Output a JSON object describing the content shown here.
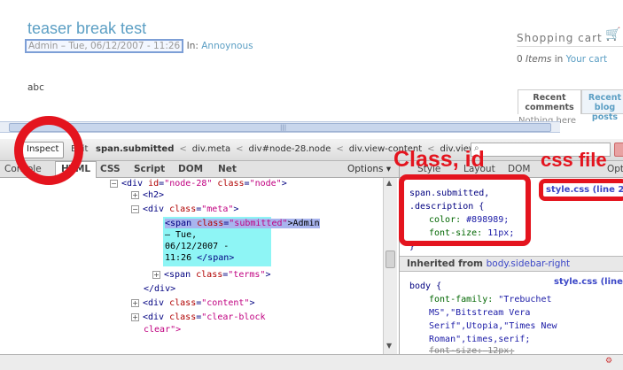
{
  "page": {
    "title": "teaser break test",
    "submitted": "Admin – Tue, 06/12/2007 - 11:26",
    "in_label": "In:",
    "category": "Annoynous",
    "body": "abc"
  },
  "cart": {
    "title": "Shopping cart",
    "count_text": "0",
    "items_text": "Items",
    "in_text": "in",
    "link": "Your cart"
  },
  "recent": {
    "tab_comments": "Recent comments",
    "tab_posts": "Recent blog posts",
    "empty_text": "Nothing here"
  },
  "firebug": {
    "toolbar": {
      "inspect": "Inspect",
      "edit": "Edit",
      "breadcrumb": [
        "span.submitted",
        "div.meta",
        "div#node-28.node",
        "div.view-content",
        "div.view"
      ]
    },
    "tabs": [
      "Console",
      "HTML",
      "CSS",
      "Script",
      "DOM",
      "Net"
    ],
    "active_tab": "HTML",
    "options": "Options ▾",
    "right_tabs": [
      "Style",
      "Layout",
      "DOM"
    ],
    "right_options": "Options",
    "tree": [
      {
        "tag_open": "<div",
        "attr1": "id",
        "val1": "\"node-28\"",
        "attr2": "class",
        "val2": "\"node\"",
        "close": ">"
      },
      {
        "text": "<h2>"
      },
      {
        "text_open": "<div",
        "attr": "class",
        "val": "\"meta\"",
        "close": ">"
      },
      {
        "text": "<span",
        "attr": "class",
        "val": "\"terms\"",
        "close": ">"
      },
      {
        "text": "</div>"
      },
      {
        "text_open": "<div",
        "attr": "class",
        "val": "\"content\"",
        "close": ">"
      },
      {
        "text_open": "<div",
        "attr": "class",
        "val": "\"clear-block",
        "cont": "clear\">"
      }
    ],
    "selected_node": {
      "line1_open": "<span",
      "line1_attr": "class",
      "line1_val": "\"submitted\"",
      "line1_text": ">Admin",
      "line2": "– Tue,",
      "line3": "06/12/2007 -",
      "line4_text": "11:26",
      "line4_close": "</span>"
    },
    "style": {
      "selector_1": "span.submitted,",
      "selector_2": ".description {",
      "prop_color": "color:",
      "val_color": "#898989;",
      "prop_size": "font-size:",
      "val_size": "11px;",
      "close": "}",
      "file_1": "style.css (line 2",
      "inherited_label": "Inherited from",
      "inherited_selector": "body.sidebar-right",
      "body_selector": "body {",
      "file_2": "style.css (line",
      "ff_prop": "font-family:",
      "ff_val_1": "\"Trebuchet",
      "ff_val_2": "MS\",\"Bitstream Vera",
      "ff_val_3": "Serif\",Utopia,\"Times New",
      "ff_val_4": "Roman\",times,serif;",
      "fs_prop": "font-size:",
      "fs_val": "12px;"
    }
  },
  "annotations": {
    "class_id": "Class, id",
    "css_file": "css file",
    "highlight_color": "#e4141e"
  }
}
